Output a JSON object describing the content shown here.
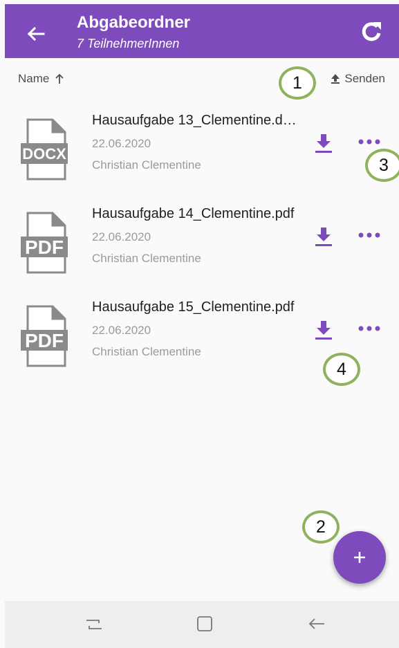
{
  "header": {
    "title": "Abgabeordner",
    "subtitle": "7 TeilnehmerInnen",
    "color": "#7e4bbd"
  },
  "toolbar": {
    "sort_label": "Name",
    "sort_icon": "arrow-up-icon",
    "send_label": "Senden",
    "send_icon": "upload-icon"
  },
  "files": [
    {
      "type": "DOCX",
      "name": "Hausaufgabe 13_Clementine.d…",
      "date": "22.06.2020",
      "author": "Christian Clementine"
    },
    {
      "type": "PDF",
      "name": "Hausaufgabe 14_Clementine.pdf",
      "date": "22.06.2020",
      "author": "Christian Clementine"
    },
    {
      "type": "PDF",
      "name": "Hausaufgabe 15_Clementine.pdf",
      "date": "22.06.2020",
      "author": "Christian Clementine"
    }
  ],
  "callouts": [
    "1",
    "2",
    "3",
    "4"
  ],
  "fab": {
    "label": "+"
  },
  "colors": {
    "accent": "#7e4bbd",
    "callout_ring": "#8fb35c",
    "icon_gray": "#8a8a8a"
  }
}
